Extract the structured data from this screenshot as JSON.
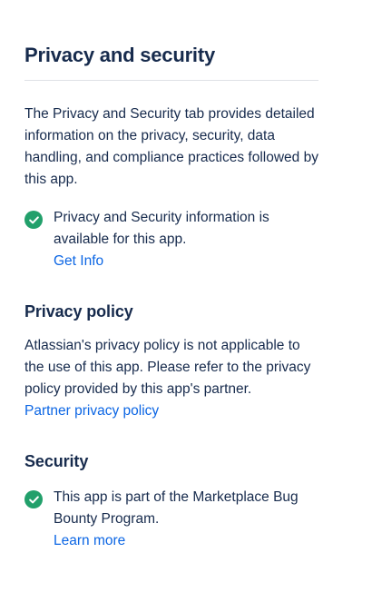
{
  "page": {
    "title": "Privacy and security",
    "intro": "The Privacy and Security tab provides detailed information on the privacy, security, data handling, and compliance practices followed by this app."
  },
  "privacy_info": {
    "status_icon": "check-circle-icon",
    "status_color": "#22a06b",
    "text": "Privacy and Security information is available for this app.",
    "link_label": "Get Info"
  },
  "privacy_policy": {
    "heading": "Privacy policy",
    "body": "Atlassian's privacy policy is not applicable to the use of this app. Please refer to the privacy policy provided by this app's partner.",
    "link_label": "Partner privacy policy"
  },
  "security": {
    "heading": "Security",
    "status_icon": "check-circle-icon",
    "status_color": "#22a06b",
    "text": "This app is part of the Marketplace Bug Bounty Program.",
    "link_label": "Learn more"
  },
  "colors": {
    "text": "#172b4d",
    "link": "#0c66e4",
    "divider": "#dfe1e6"
  }
}
